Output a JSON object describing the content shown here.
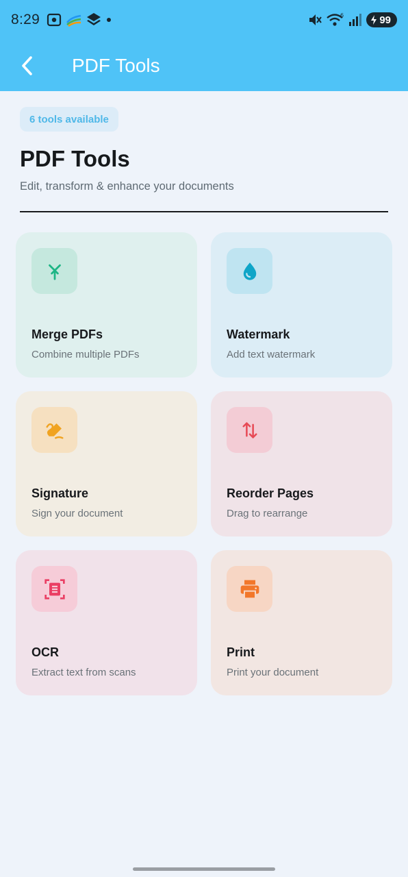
{
  "status": {
    "time": "8:29",
    "battery": "99",
    "notification_icons": [
      "screenshot-icon",
      "multicolor-app-icon",
      "layers-app-icon",
      "dot-icon"
    ],
    "system_icons": [
      "mute-icon",
      "wifi-icon",
      "signal-icon",
      "battery-icon"
    ]
  },
  "appbar": {
    "title": "PDF Tools",
    "back_icon": "chevron-left-icon"
  },
  "header": {
    "badge": "6 tools available",
    "title": "PDF Tools",
    "subtitle": "Edit, transform & enhance your documents"
  },
  "tools": [
    {
      "title": "Merge PDFs",
      "description": "Combine multiple PDFs",
      "icon": "merge-icon",
      "bg": "#dff0ee",
      "icon_bg": "#c5e8de",
      "icon_color": "#1eb585"
    },
    {
      "title": "Watermark",
      "description": "Add text watermark",
      "icon": "water-drop-icon",
      "bg": "#dcedf6",
      "icon_bg": "#bfe4f1",
      "icon_color": "#0fa5c8"
    },
    {
      "title": "Signature",
      "description": "Sign your document",
      "icon": "signature-icon",
      "bg": "#f2ede3",
      "icon_bg": "#f6e0c0",
      "icon_color": "#f0a321"
    },
    {
      "title": "Reorder Pages",
      "description": "Drag to rearrange",
      "icon": "swap-vertical-icon",
      "bg": "#f0e3e8",
      "icon_bg": "#f3ccd5",
      "icon_color": "#e74a56"
    },
    {
      "title": "OCR",
      "description": "Extract text from scans",
      "icon": "document-scanner-icon",
      "bg": "#f1e2ea",
      "icon_bg": "#f6ccd8",
      "icon_color": "#ea3f64"
    },
    {
      "title": "Print",
      "description": "Print your document",
      "icon": "printer-icon",
      "bg": "#f2e6e2",
      "icon_bg": "#f7d6c4",
      "icon_color": "#f2772a"
    }
  ],
  "colors": {
    "appbar": "#4fc3f7",
    "background": "#eef3fa",
    "badge_text": "#4fb8e8"
  }
}
